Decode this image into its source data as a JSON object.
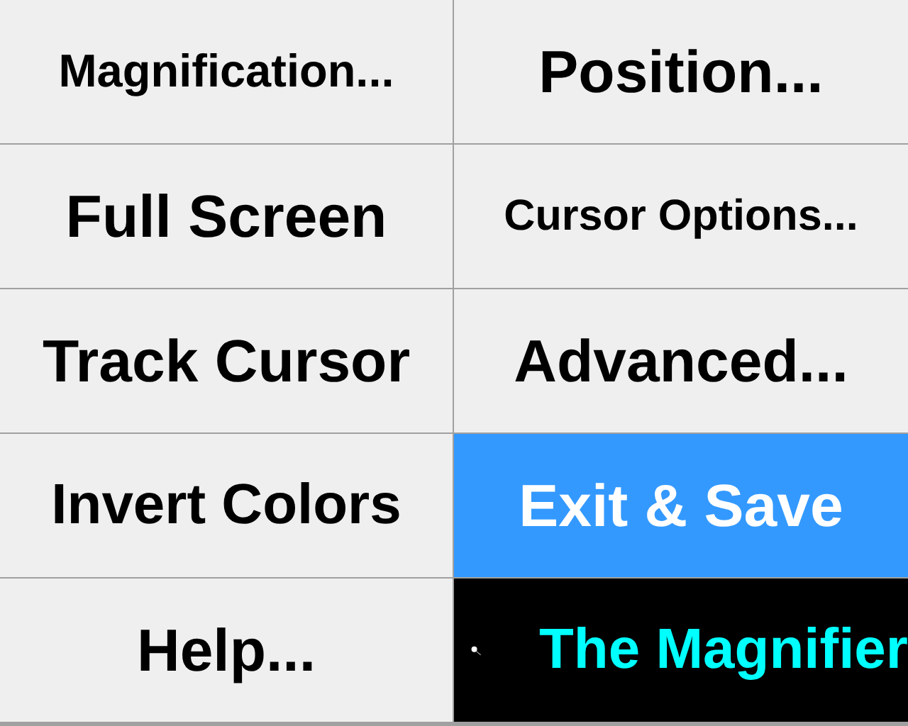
{
  "buttons": [
    {
      "label": "Magnification...",
      "kind": "option",
      "selected": false
    },
    {
      "label": "Position...",
      "kind": "option",
      "selected": false
    },
    {
      "label": "Full Screen",
      "kind": "option",
      "selected": false
    },
    {
      "label": "Cursor Options...",
      "kind": "option",
      "selected": false
    },
    {
      "label": "Track Cursor",
      "kind": "option",
      "selected": false
    },
    {
      "label": "Advanced...",
      "kind": "option",
      "selected": false
    },
    {
      "label": "Invert Colors",
      "kind": "option",
      "selected": false
    },
    {
      "label": "Exit & Save",
      "kind": "option",
      "selected": true
    },
    {
      "label": "Help...",
      "kind": "option",
      "selected": false
    },
    {
      "label": "The Magnifier",
      "kind": "banner",
      "selected": false
    }
  ]
}
